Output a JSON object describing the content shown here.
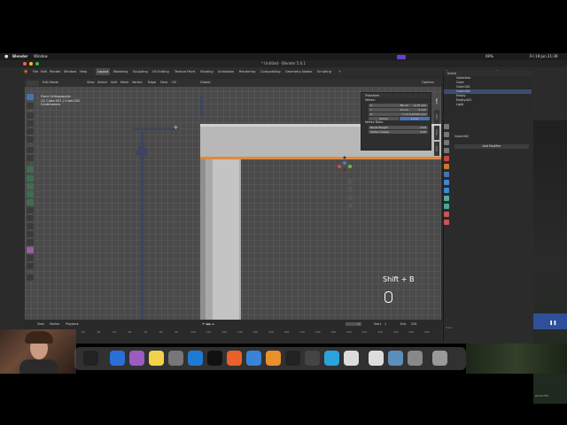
{
  "colors": {
    "accent_blue": "#4772b3",
    "viewport_bg": "#4a4a4a",
    "panel_bg": "#2e2e2e",
    "selection_orange": "#e08a3c"
  },
  "mac_menubar": {
    "app": "Blender",
    "menu": "Window",
    "battery": "69%",
    "date_time": "Fri 19 Jun 21:39"
  },
  "window": {
    "title": "* Untitled - Blender 5.0.1"
  },
  "blender_menu": {
    "items": [
      "File",
      "Edit",
      "Render",
      "Window",
      "Help"
    ],
    "workspaces": [
      "Layout",
      "Modeling",
      "Sculpting",
      "UV Editing",
      "Texture Paint",
      "Shading",
      "Animation",
      "Rendering",
      "Compositing",
      "Geometry Nodes",
      "Scripting"
    ],
    "active_workspace": "Layout",
    "scene": "Scene",
    "view_layer": "ViewLayer"
  },
  "viewport_header": {
    "mode": "Edit Mode",
    "menus": [
      "View",
      "Select",
      "Add",
      "Mesh",
      "Vertex",
      "Edge",
      "Face",
      "UV"
    ],
    "orientation": "Global",
    "options": "Options"
  },
  "viewport_info": {
    "line1": "Front Orthographic",
    "line2": "(2) Cube.001 | Cube.002",
    "line3": "Centimeters"
  },
  "n_panel": {
    "title": "Transform",
    "section": "Vertex:",
    "x_label": "X",
    "x_value": "-88 cm",
    "x_extra": "-2.25 mm",
    "y_label": "Y",
    "y_value": "10 cm",
    "y_extra": "0 mm",
    "z_label": "Z",
    "z_value": "7 cm",
    "z_extra": "6.97445 mm",
    "global": "Global",
    "local": "Local",
    "vertex_data": "Vertex Data:",
    "bevel_label": "Bevel Weight",
    "bevel_value": "0.00",
    "crease_label": "Vertex Crease",
    "crease_value": "0.00"
  },
  "side_tabs": [
    "Item",
    "Tool",
    "View",
    "Edit"
  ],
  "shortcut_overlay": "Shift + B",
  "outliner": {
    "header": "Scene",
    "rows": [
      "Collection",
      "Cube",
      "Cube.001",
      "Cube.002",
      "Empty",
      "Empty.001",
      "Light"
    ]
  },
  "properties": {
    "object": "Cube.002",
    "add_modifier": "Add Modifier"
  },
  "timeline": {
    "menus": [
      "View",
      "Marker",
      "Playback"
    ],
    "current_frame": "1",
    "start_label": "Start",
    "start": "1",
    "end_label": "End",
    "end": "250",
    "ticks": [
      "0",
      "10",
      "20",
      "30",
      "40",
      "50",
      "60",
      "70",
      "80",
      "90",
      "100",
      "110",
      "120",
      "130",
      "140",
      "150",
      "160",
      "170",
      "180",
      "190",
      "200",
      "210",
      "220",
      "230",
      "240",
      "250"
    ]
  },
  "status_bar": {
    "version": "5.0.1",
    "fps": "60.00 FPS"
  }
}
